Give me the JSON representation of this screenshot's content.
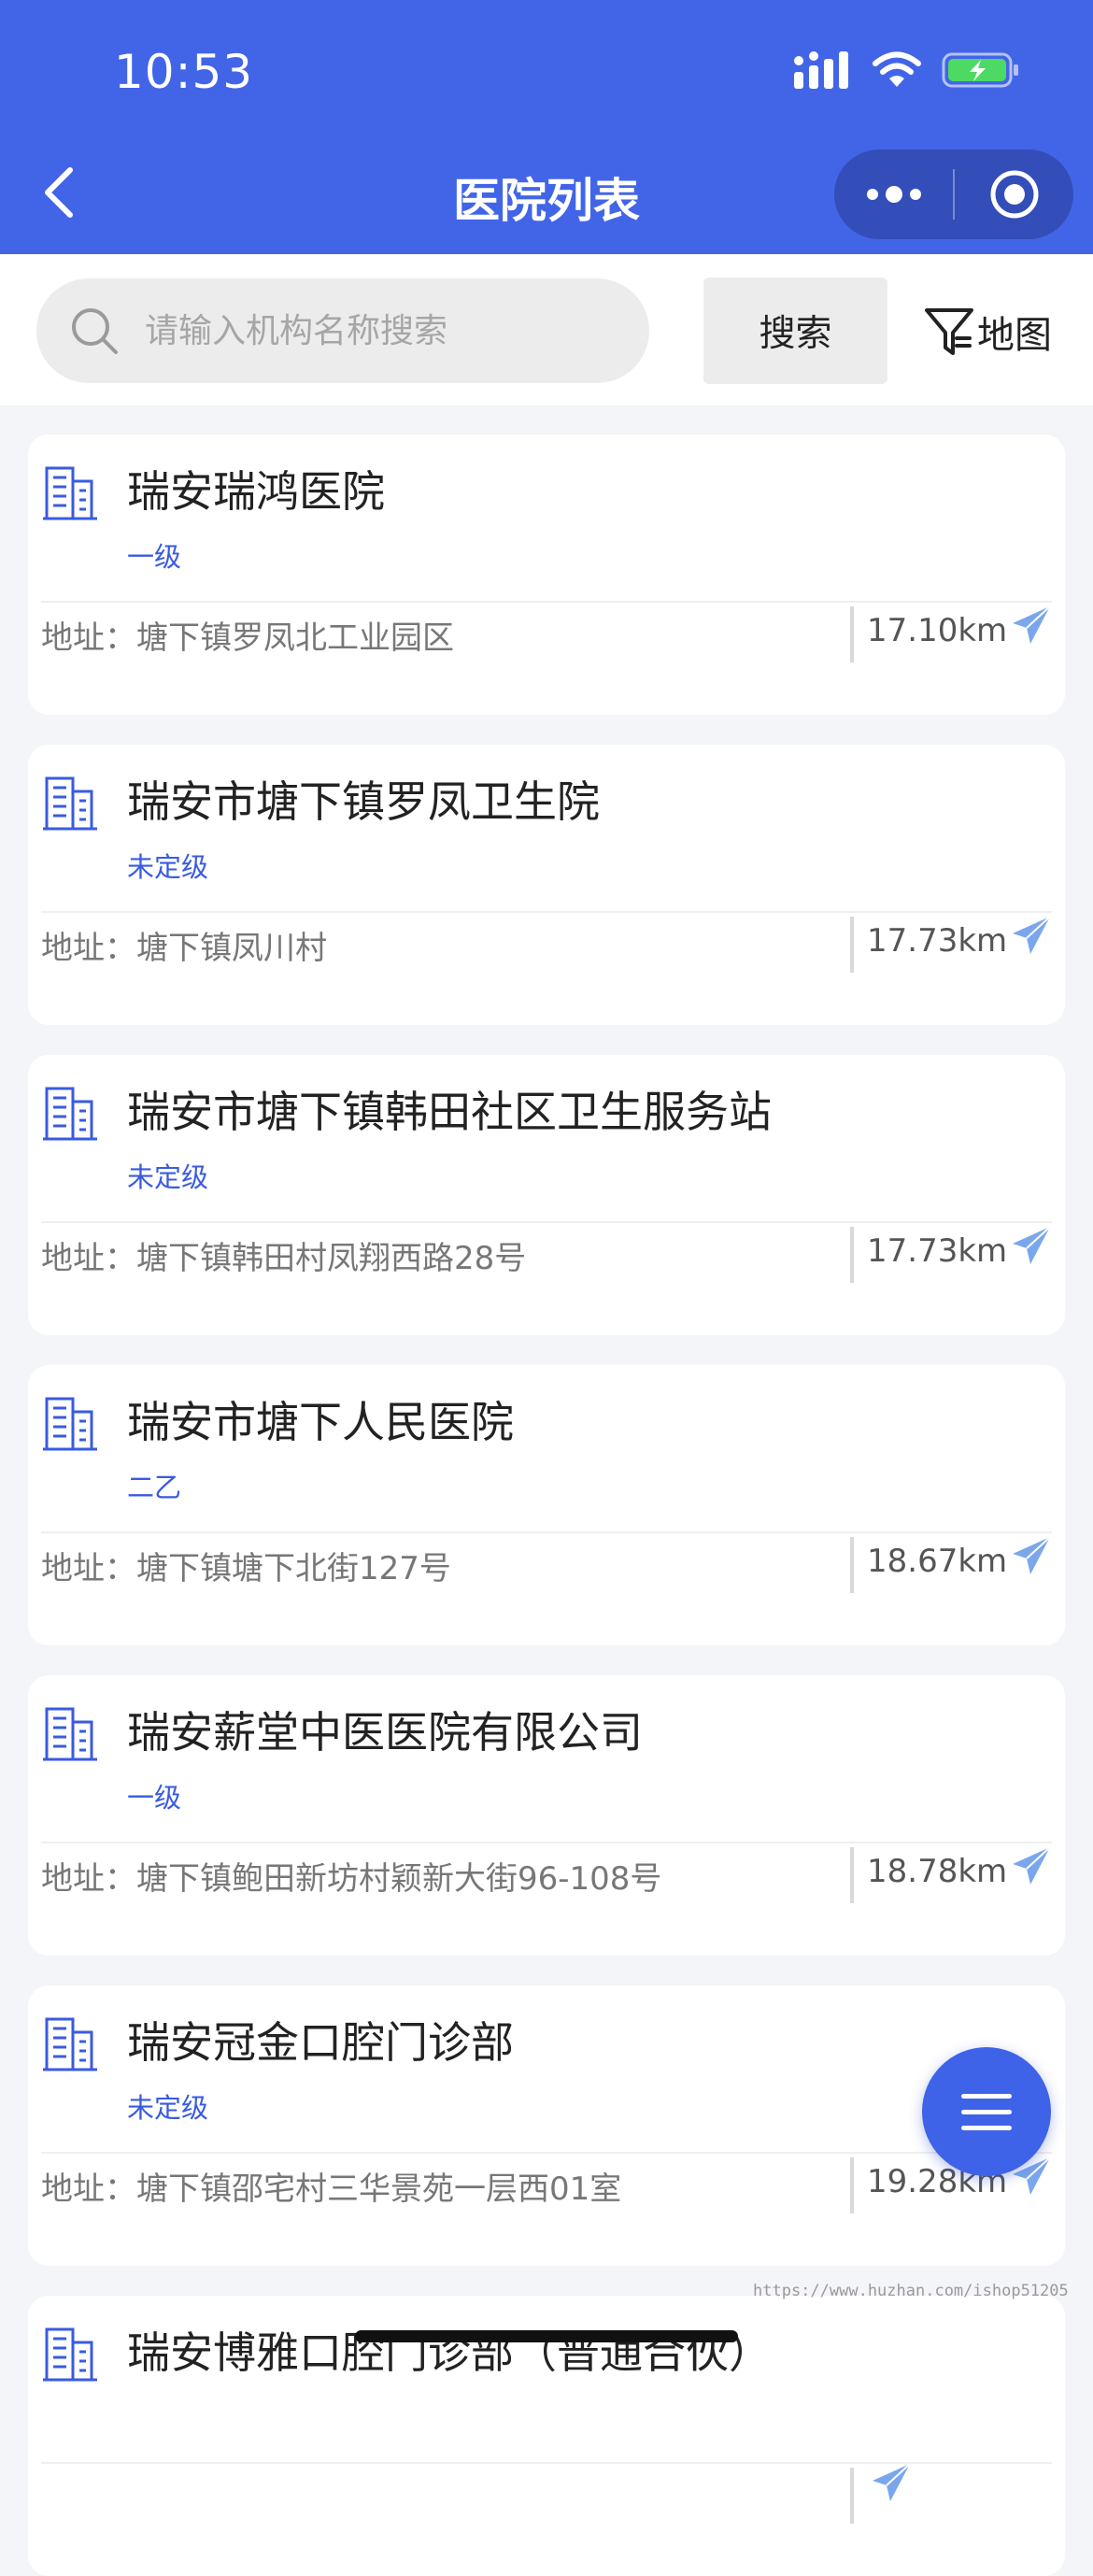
{
  "status": {
    "time": "10:53"
  },
  "nav": {
    "title": "医院列表"
  },
  "search": {
    "placeholder": "请输入机构名称搜索",
    "button_label": "搜索",
    "map_label": "地图"
  },
  "hospitals": [
    {
      "name": "瑞安瑞鸿医院",
      "level": "一级",
      "address": "地址：塘下镇罗凤北工业园区",
      "distance": "17.10km"
    },
    {
      "name": "瑞安市塘下镇罗凤卫生院",
      "level": "未定级",
      "address": "地址：塘下镇凤川村",
      "distance": "17.73km"
    },
    {
      "name": "瑞安市塘下镇韩田社区卫生服务站",
      "level": "未定级",
      "address": "地址：塘下镇韩田村凤翔西路28号",
      "distance": "17.73km"
    },
    {
      "name": "瑞安市塘下人民医院",
      "level": "二乙",
      "address": "地址：塘下镇塘下北街127号",
      "distance": "18.67km"
    },
    {
      "name": "瑞安薪堂中医医院有限公司",
      "level": "一级",
      "address": "地址：塘下镇鲍田新坊村颖新大街96-108号",
      "distance": "18.78km"
    },
    {
      "name": "瑞安冠金口腔门诊部",
      "level": "未定级",
      "address": "地址：塘下镇邵宅村三华景苑一层西01室",
      "distance": "19.28km"
    },
    {
      "name": "瑞安博雅口腔门诊部（普通合伙）",
      "level": "",
      "address": "",
      "distance": ""
    }
  ],
  "watermark": "https://www.huzhan.com/ishop51205",
  "colors": {
    "primary": "#4265e8",
    "level_text": "#3a5be0",
    "nav_icon": "#7aa7ec"
  },
  "icons": [
    "back-icon",
    "more-icon",
    "target-icon",
    "search-icon",
    "filter-icon",
    "building-icon",
    "send-icon",
    "menu-icon"
  ]
}
